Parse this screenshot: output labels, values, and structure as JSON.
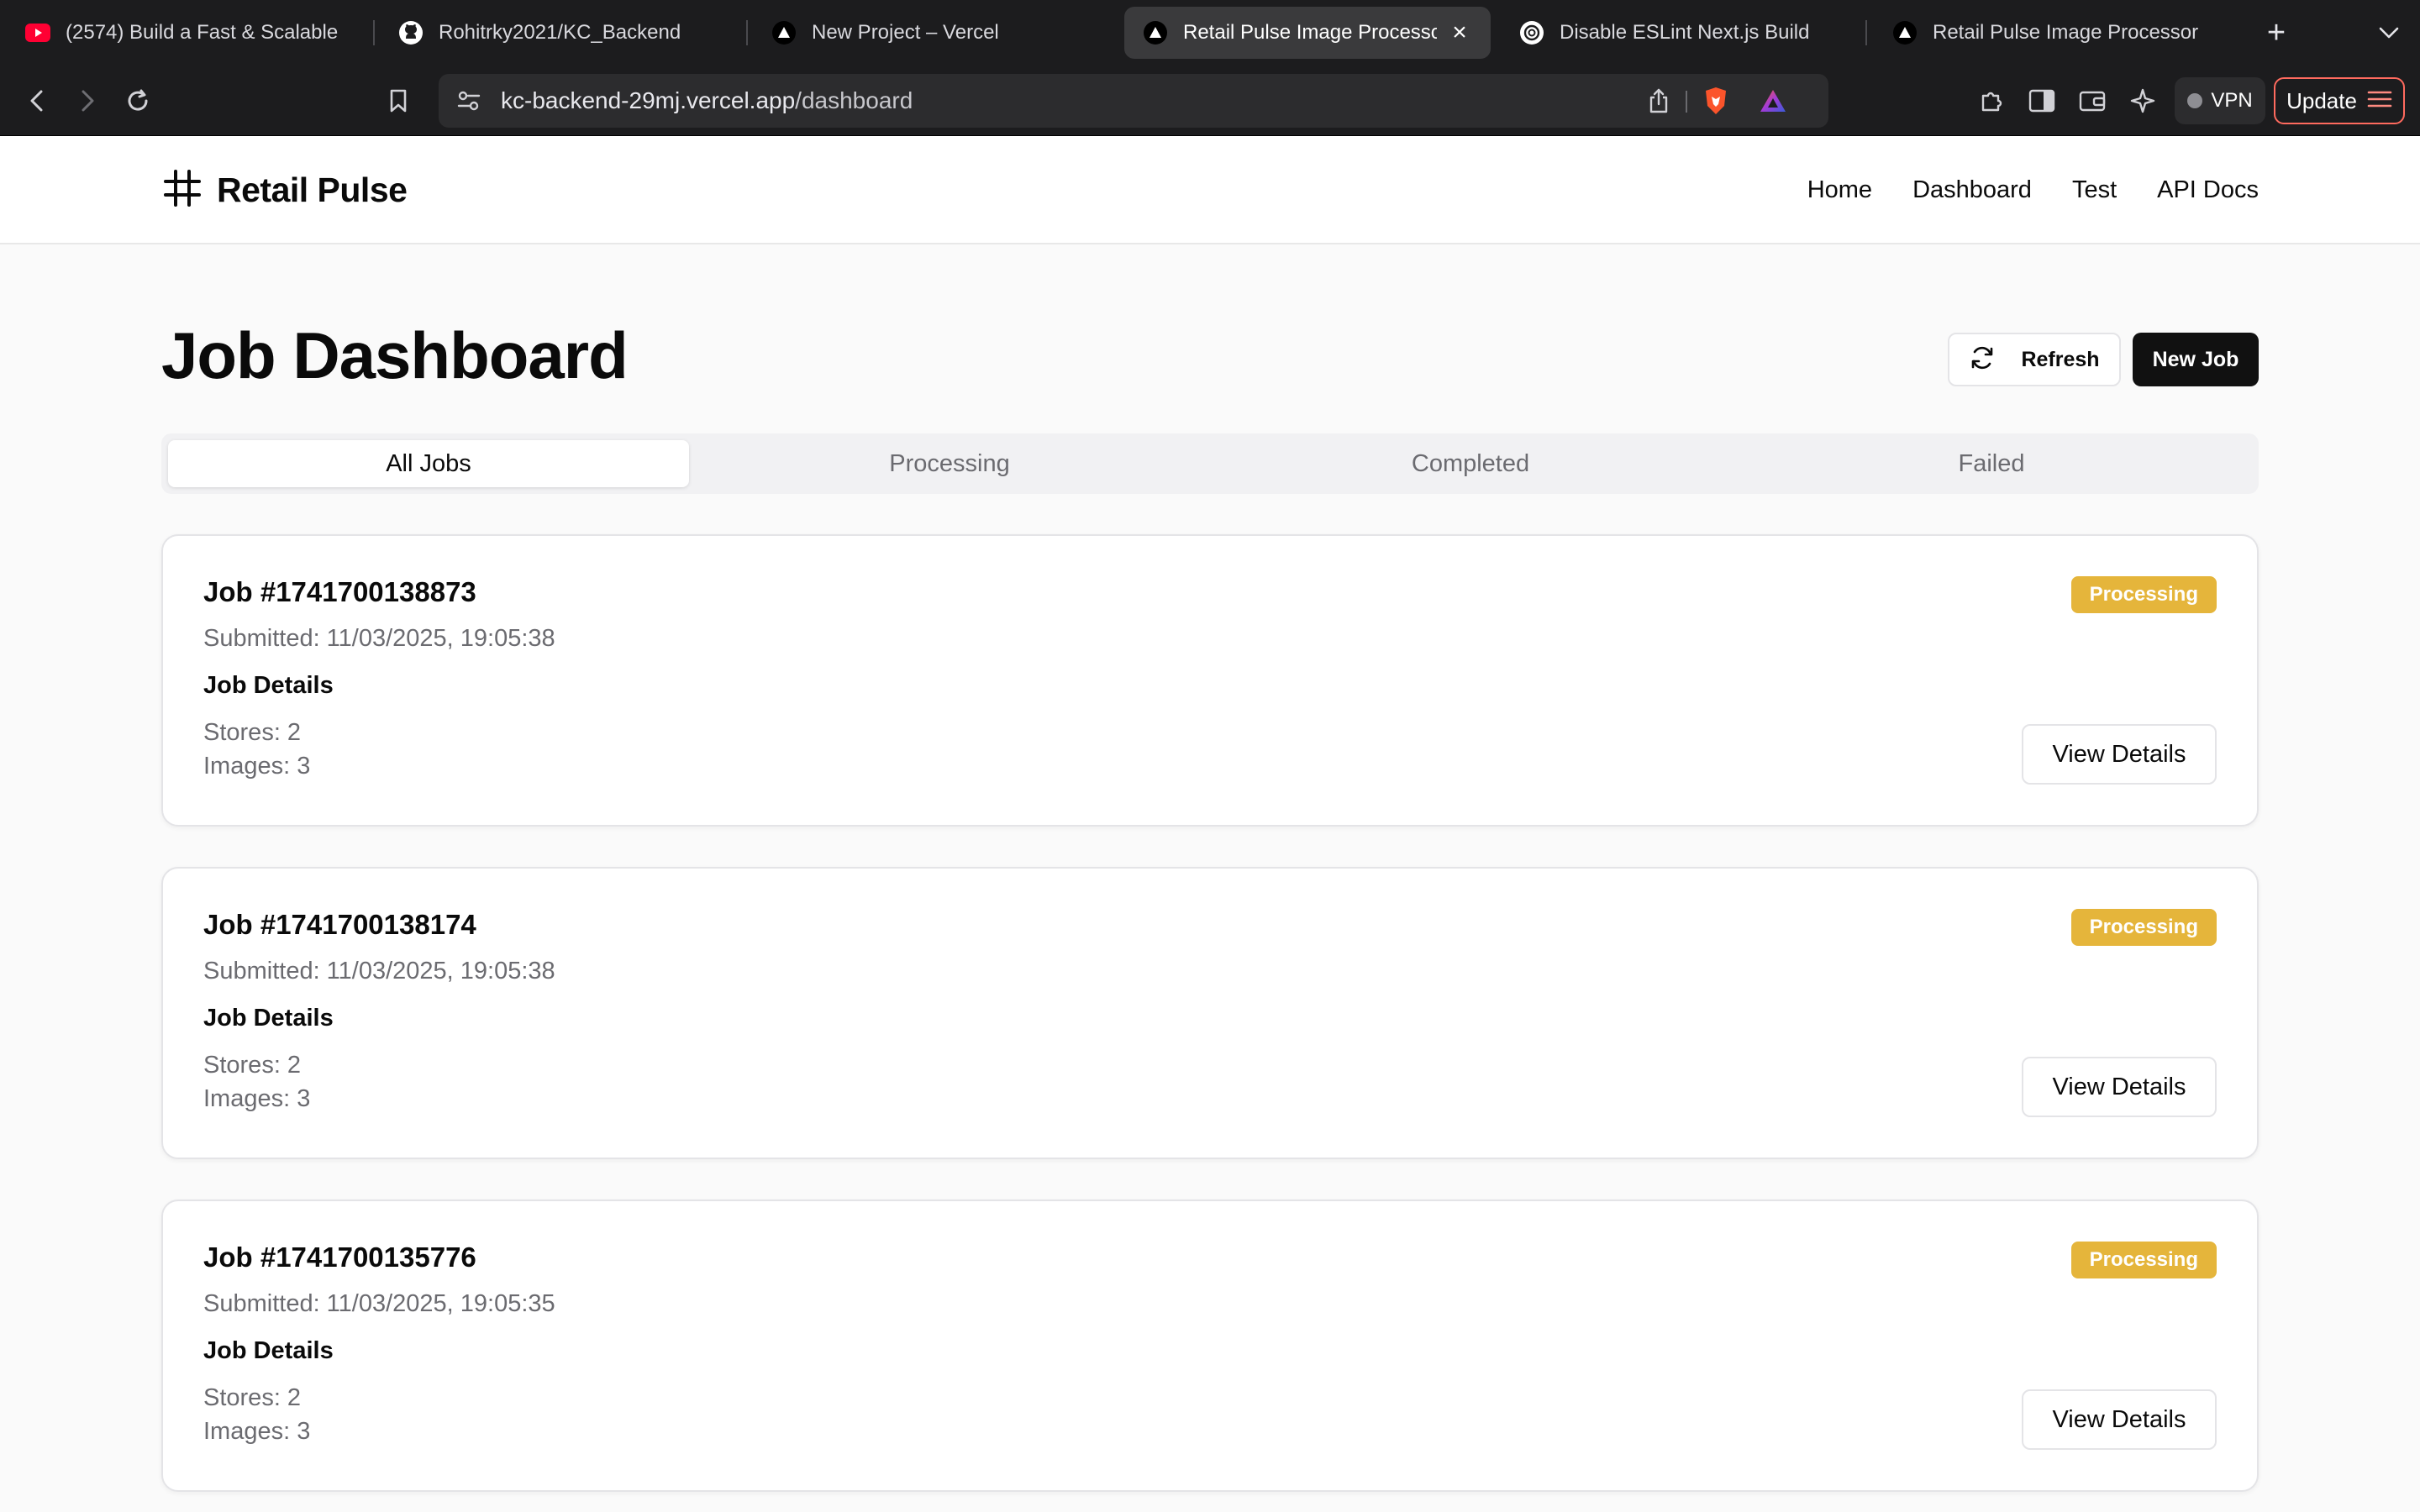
{
  "browser": {
    "tabs": [
      {
        "title": "(2574) Build a Fast & Scalable",
        "favicon": "youtube-icon",
        "active": false
      },
      {
        "title": "Rohitrky2021/KC_Backend",
        "favicon": "github-icon",
        "active": false
      },
      {
        "title": "New Project – Vercel",
        "favicon": "vercel-icon",
        "active": false
      },
      {
        "title": "Retail Pulse Image Processor",
        "favicon": "vercel-icon",
        "active": true
      },
      {
        "title": "Disable ESLint Next.js Build",
        "favicon": "chatgpt-icon",
        "active": false
      },
      {
        "title": "Retail Pulse Image Processor",
        "favicon": "vercel-icon",
        "active": false
      }
    ],
    "url_host": "kc-backend-29mj.vercel.app",
    "url_path": "/dashboard",
    "vpn_label": "VPN",
    "update_label": "Update"
  },
  "site": {
    "brand": "Retail Pulse",
    "nav": [
      "Home",
      "Dashboard",
      "Test",
      "API Docs"
    ]
  },
  "page": {
    "title": "Job Dashboard",
    "refresh_label": "Refresh",
    "new_job_label": "New Job",
    "filter_tabs": [
      "All Jobs",
      "Processing",
      "Completed",
      "Failed"
    ],
    "active_filter": "All Jobs"
  },
  "jobs": [
    {
      "title": "Job #1741700138873",
      "submitted": "Submitted: 11/03/2025, 19:05:38",
      "section": "Job Details",
      "stores": "Stores: 2",
      "images": "Images: 3",
      "status": "Processing",
      "action": "View Details"
    },
    {
      "title": "Job #1741700138174",
      "submitted": "Submitted: 11/03/2025, 19:05:38",
      "section": "Job Details",
      "stores": "Stores: 2",
      "images": "Images: 3",
      "status": "Processing",
      "action": "View Details"
    },
    {
      "title": "Job #1741700135776",
      "submitted": "Submitted: 11/03/2025, 19:05:35",
      "section": "Job Details",
      "stores": "Stores: 2",
      "images": "Images: 3",
      "status": "Processing",
      "action": "View Details"
    }
  ],
  "colors": {
    "status_processing": "#e5b53b",
    "primary_button": "#111111",
    "update_border": "#ff6a5e"
  }
}
